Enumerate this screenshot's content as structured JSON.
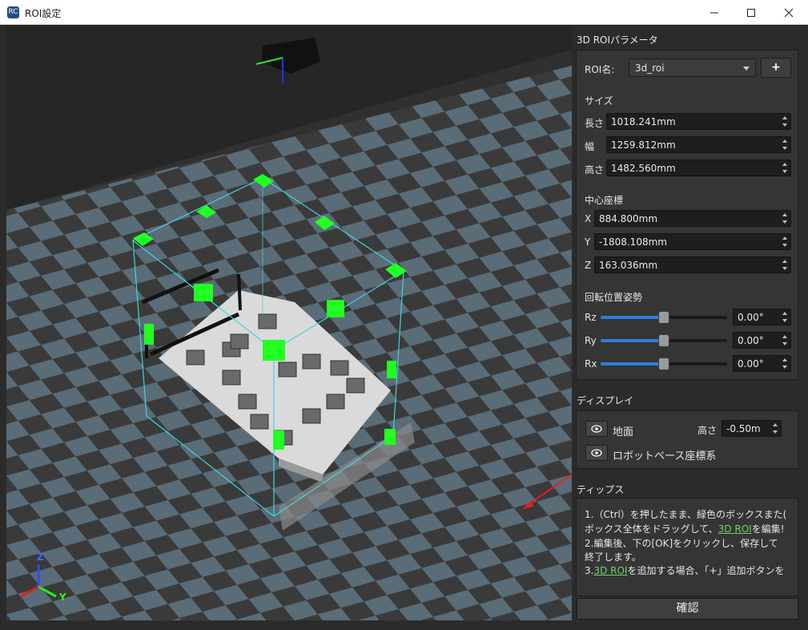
{
  "window": {
    "title": "ROI設定",
    "app_icon_text": "RC"
  },
  "viewport": {
    "axis_labels": {
      "z": "Z",
      "y": "Y"
    }
  },
  "panel": {
    "roi_params_title": "3D ROIパラメータ",
    "roi_name_label": "ROI名:",
    "roi_name_value": "3d_roi",
    "add_label": "+",
    "size_title": "サイズ",
    "size": [
      {
        "label": "長さ",
        "value": "1018.241mm"
      },
      {
        "label": "幅",
        "value": "1259.812mm"
      },
      {
        "label": "高さ",
        "value": "1482.560mm"
      }
    ],
    "center_title": "中心座標",
    "center": [
      {
        "label": "X",
        "value": "884.800mm"
      },
      {
        "label": "Y",
        "value": "-1808.108mm"
      },
      {
        "label": "Z",
        "value": "163.036mm"
      }
    ],
    "rotation_title": "回転位置姿勢",
    "rotation": [
      {
        "label": "Rz",
        "value": "0.00°",
        "level": 0.5
      },
      {
        "label": "Ry",
        "value": "0.00°",
        "level": 0.5
      },
      {
        "label": "Rx",
        "value": "0.00°",
        "level": 0.5
      }
    ],
    "display_title": "ディスプレイ",
    "ground_label": "地面",
    "height_label": "高さ",
    "height_value": "-0.50m",
    "robot_base_label": "ロボットベース座標系",
    "tips_title": "ティップス",
    "tips": {
      "l1": "1.（Ctrl）を押したまま、緑色のボックスまた(",
      "l2a": "ボックス全体をドラッグして、",
      "l2link": "3D ROI",
      "l2b": "を編集!",
      "l3": "2.編集後、下の[OK]をクリックし、保存して",
      "l4": "終了します。",
      "l5a": "3.",
      "l5link": "3D ROI",
      "l5b": "を追加する場合、「+」追加ボタンを"
    },
    "confirm_label": "確認"
  },
  "colors": {
    "accent": "#2f7fd8",
    "handle_green": "#22ff22",
    "box_edge": "#3fd6e0",
    "link": "#6fd36f"
  }
}
